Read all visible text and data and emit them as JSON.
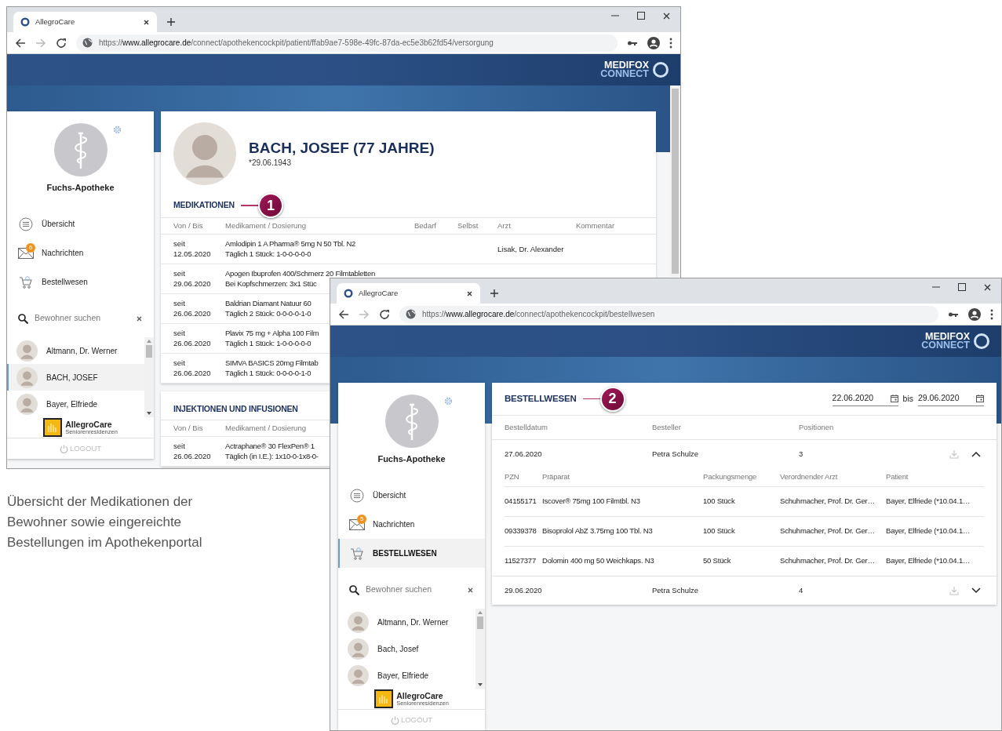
{
  "windows": [
    {
      "tab_title": "AllegroCare",
      "url": {
        "scheme": "https://",
        "host": "www.allegrocare.de",
        "path": "/connect/apothekencockpit/patient/ffab9ae7-598e-49fc-87da-ec5e3b62fd54/versorgung"
      },
      "logo": {
        "line_1": "MEDIFOX",
        "line_2": "CONNECT"
      },
      "sidebar": {
        "pharmacy_name": "Fuchs-Apotheke",
        "nav": [
          {
            "kind": "overview",
            "label": "Übersicht",
            "selected": false
          },
          {
            "kind": "messages",
            "label": "Nachrichten",
            "badge": "6",
            "selected": false
          },
          {
            "kind": "orders",
            "label": "Bestellwesen",
            "selected": false
          }
        ],
        "search": {
          "placeholder": "Bewohner suchen"
        },
        "residents": [
          {
            "name": "Altmann, Dr. Werner",
            "selected": false
          },
          {
            "name": "BACH, JOSEF",
            "selected": true
          },
          {
            "name": "Bayer, Elfriede",
            "selected": false
          }
        ],
        "brand": {
          "name": "AllegroCare",
          "subtitle": "Seniorenresidenzen"
        },
        "logout": "LOGOUT"
      },
      "main": {
        "kind": "patient",
        "patient_name": "BACH, JOSEF (77 JAHRE)",
        "birth_date": "*29.06.1943",
        "sections": [
          {
            "title": "MEDIKATIONEN",
            "callout": "1",
            "columns": [
              "Von / Bis",
              "Medikament / Dosierung",
              "Bedarf",
              "Selbst",
              "Arzt",
              "Kommentar"
            ],
            "rows": [
              {
                "period": "seit",
                "date": "12.05.2020",
                "drug": "Amlodipin 1 A Pharma® 5mg N 50 Tbl. N2",
                "dosage": "Täglich 1 Stück: 1-0-0-0-0-0",
                "doctor": "Lisak, Dr. Alexander"
              },
              {
                "period": "seit",
                "date": "29.06.2020",
                "drug": "Apogen Ibuprofen 400/Schmerz 20 Filmtabletten",
                "dosage": "Bei Kopfschmerzen: 3x1 Stüc"
              },
              {
                "period": "seit",
                "date": "26.06.2020",
                "drug": "Baldrian Diamant Natuur 60",
                "dosage": "Täglich 2 Stück: 0-0-0-0-1-0"
              },
              {
                "period": "seit",
                "date": "26.06.2020",
                "drug": "Plavix 75 mg + Alpha 100 Film",
                "dosage": "Täglich 1 Stück: 1-0-0-0-0-0"
              },
              {
                "period": "seit",
                "date": "26.06.2020",
                "drug": "SIMVA BASICS 20mg Filmtab",
                "dosage": "Täglich 1 Stück: 0-0-0-0-1-0"
              }
            ]
          },
          {
            "title": "INJEKTIONEN UND INFUSIONEN",
            "columns": [
              "Von / Bis",
              "Medikament / Dosierung"
            ],
            "rows": [
              {
                "period": "seit",
                "date": "26.06.2020",
                "drug": "Actraphane® 30 FlexPen® 1",
                "dosage": "Täglich (in I.E.): 1x10-0-1x8-0-"
              }
            ]
          }
        ]
      }
    },
    {
      "tab_title": "AllegroCare",
      "url": {
        "scheme": "https://",
        "host": "www.allegrocare.de",
        "path": "/connect/apothekencockpit/bestellwesen"
      },
      "logo": {
        "line_1": "MEDIFOX",
        "line_2": "CONNECT"
      },
      "sidebar": {
        "pharmacy_name": "Fuchs-Apotheke",
        "nav": [
          {
            "kind": "overview",
            "label": "Übersicht",
            "selected": false
          },
          {
            "kind": "messages",
            "label": "Nachrichten",
            "badge": "5",
            "selected": false
          },
          {
            "kind": "orders",
            "label": "BESTELLWESEN",
            "selected": true
          }
        ],
        "search": {
          "placeholder": "Bewohner suchen"
        },
        "residents": [
          {
            "name": "Altmann, Dr. Werner",
            "selected": false
          },
          {
            "name": "Bach, Josef",
            "selected": false
          },
          {
            "name": "Bayer, Elfriede",
            "selected": false
          }
        ],
        "brand": {
          "name": "AllegroCare",
          "subtitle": "Seniorenresidenzen"
        },
        "logout": "LOGOUT"
      },
      "main": {
        "kind": "orders",
        "title": "BESTELLWESEN",
        "callout": "2",
        "date_from": "22.06.2020",
        "date_separator": "bis",
        "date_to": "29.06.2020",
        "columns": [
          "Bestelldatum",
          "Besteller",
          "Positionen"
        ],
        "orders": [
          {
            "date": "27.06.2020",
            "orderer": "Petra Schulze",
            "positions": "3",
            "expanded": true,
            "item_columns": [
              "PZN",
              "Präparat",
              "Packungsmenge",
              "Verordnender Arzt",
              "Patient"
            ],
            "items": [
              {
                "pzn": "04155171",
                "product": "Iscover® 75mg 100 Filmtbl. N3",
                "quantity": "100 Stück",
                "doctor": "Schuhmacher, Prof. Dr. Ger…",
                "patient": "Bayer, Elfriede (*10.04.1…"
              },
              {
                "pzn": "09339378",
                "product": "Bisoprolol AbZ 3.75mg 100 Tbl. N3",
                "quantity": "100 Stück",
                "doctor": "Schuhmacher, Prof. Dr. Ger…",
                "patient": "Bayer, Elfriede (*10.04.1…"
              },
              {
                "pzn": "11527377",
                "product": "Dolomin 400 mg 50 Weichkaps. N3",
                "quantity": "50 Stück",
                "doctor": "Schuhmacher, Prof. Dr. Ger…",
                "patient": "Bayer, Elfriede (*10.04.1…"
              }
            ]
          },
          {
            "date": "29.06.2020",
            "orderer": "Petra Schulze",
            "positions": "4",
            "expanded": false
          }
        ]
      }
    }
  ],
  "caption": "Übersicht der Medikationen der Bewohner sowie eingereichte Bestellungen im Apothekenportal"
}
